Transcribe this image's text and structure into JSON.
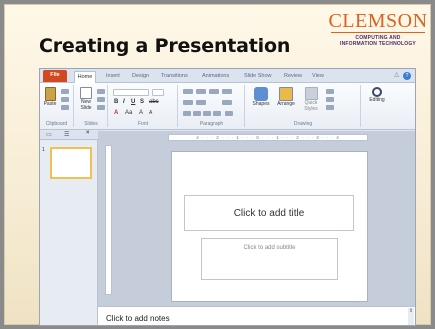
{
  "slide_title": "Creating a Presentation",
  "logo": {
    "name": "CLEMSON",
    "sub_line1": "COMPUTING AND",
    "sub_line2": "INFORMATION TECHNOLOGY"
  },
  "ribbon_tabs": [
    "File",
    "Home",
    "Insert",
    "Design",
    "Transitions",
    "Animations",
    "Slide Show",
    "Review",
    "View"
  ],
  "ribbon_groups": {
    "clipboard": {
      "label": "Clipboard",
      "paste": "Paste"
    },
    "slides": {
      "label": "Slides",
      "new_slide": "New Slide"
    },
    "font": {
      "label": "Font"
    },
    "paragraph": {
      "label": "Paragraph"
    },
    "drawing": {
      "label": "Drawing",
      "shapes": "Shapes",
      "arrange": "Arrange",
      "quick_styles": "Quick Styles"
    },
    "editing": {
      "label": "Editing"
    }
  },
  "slide_panel": {
    "slide_number": "1"
  },
  "ruler_text": "4 · · · 2 · · · 1 · · · 0 · · · 1 · · · 2 · · · 3 · · · 4",
  "placeholders": {
    "title": "Click to add title",
    "subtitle": "Click to add subtitle"
  },
  "notes": "Click to add notes",
  "colors": {
    "file_tab": "#d3491f",
    "logo_orange": "#d9621f",
    "logo_purple": "#4a2a66"
  }
}
